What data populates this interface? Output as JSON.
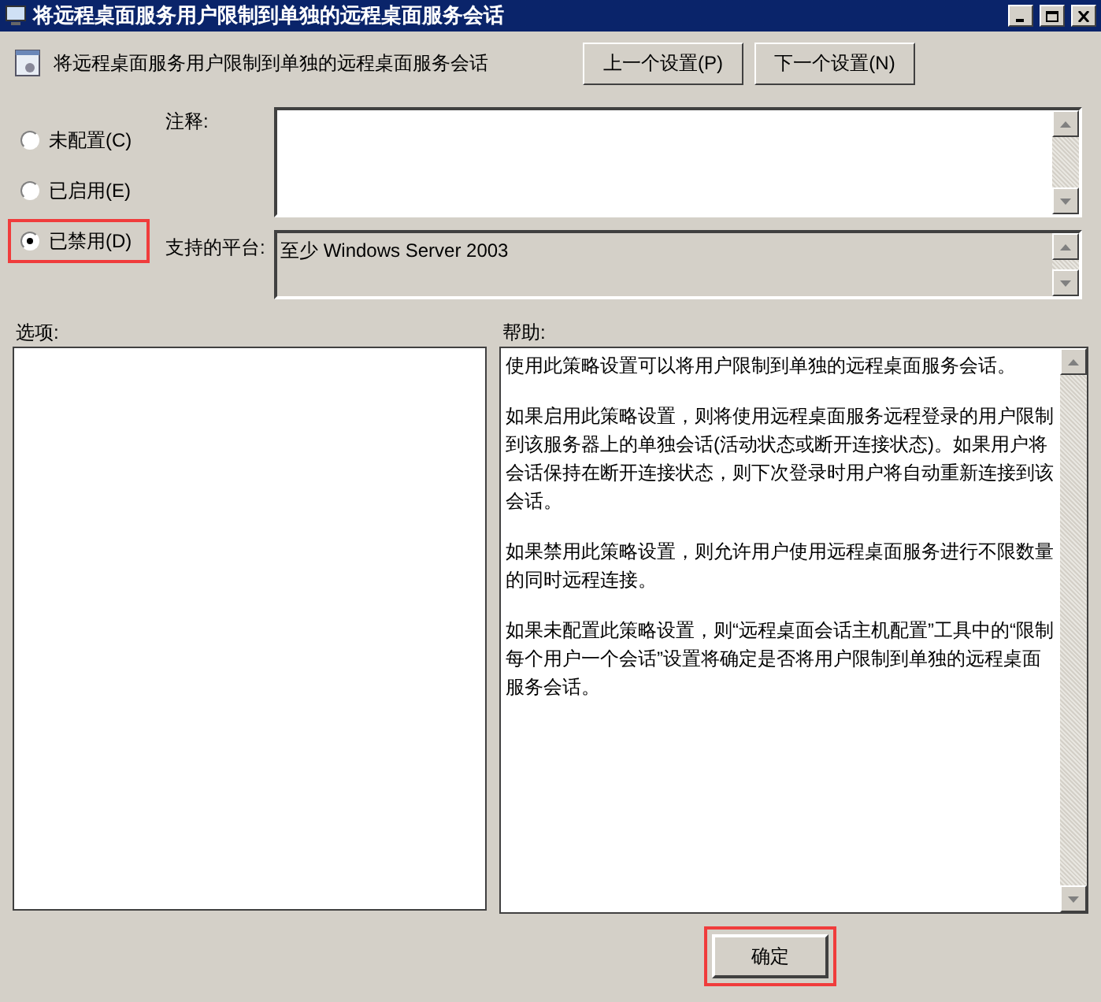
{
  "window": {
    "title": "将远程桌面服务用户限制到单独的远程桌面服务会话"
  },
  "header": {
    "setting_name": "将远程桌面服务用户限制到单独的远程桌面服务会话",
    "buttons": [
      "上一个设置(P)",
      "下一个设置(N)"
    ]
  },
  "options": [
    {
      "label": "未配置(C)",
      "selected": false,
      "highlighted": false
    },
    {
      "label": "已启用(E)",
      "selected": false,
      "highlighted": false
    },
    {
      "label": "已禁用(D)",
      "selected": true,
      "highlighted": true
    }
  ],
  "comment": {
    "label": "注释:"
  },
  "platform": {
    "label": "支持的平台:",
    "value": "至少 Windows Server 2003"
  },
  "options_panel": {
    "label": "选项:"
  },
  "help": {
    "label": "帮助:",
    "paragraphs": [
      "使用此策略设置可以将用户限制到单独的远程桌面服务会话。",
      "如果启用此策略设置，则将使用远程桌面服务远程登录的用户限制到该服务器上的单独会话(活动状态或断开连接状态)。如果用户将会话保持在断开连接状态，则下次登录时用户将自动重新连接到该会话。",
      "如果禁用此策略设置，则允许用户使用远程桌面服务进行不限数量的同时远程连接。",
      "如果未配置此策略设置，则“远程桌面会话主机配置”工具中的“限制每个用户一个会话”设置将确定是否将用户限制到单独的远程桌面服务会话。"
    ]
  },
  "footer_buttons": [
    {
      "label": "确定",
      "highlighted": true
    }
  ]
}
